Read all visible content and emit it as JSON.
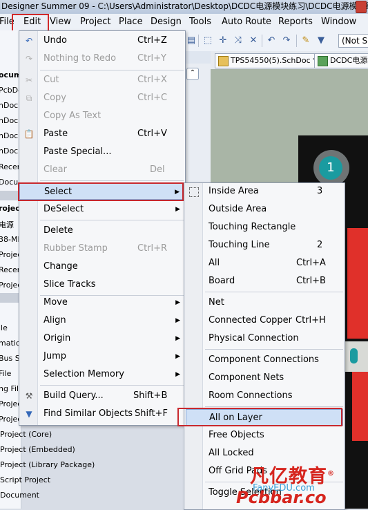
{
  "title": "Designer Summer 09 - C:\\Users\\Administrator\\Desktop\\DCDC电源模块练习\\DCDC电源模块练习",
  "menubar": [
    "File",
    "Edit",
    "View",
    "Project",
    "Place",
    "Design",
    "Tools",
    "Auto Route",
    "Reports",
    "Window"
  ],
  "toolbar": {
    "layer_field": "(Not S"
  },
  "tabs": [
    "TPS54550(5).SchDoc *",
    "DCDC电源模"
  ],
  "left_panel": {
    "rows": [
      "ocum",
      "PcbDoc",
      "hDoc",
      "hDoc",
      "hDoc",
      "hDoc",
      "Recen",
      "Docum",
      "rojec",
      "电源",
      "38-MI",
      "Projec",
      "Recen",
      "Projec",
      "ile",
      "matic S",
      "Bus Sy",
      "File",
      "ng File",
      "Projec",
      "Projec"
    ],
    "project_list": [
      "Project (Core)",
      "Project (Embedded)",
      "Project (Library Package)",
      "Script Project",
      "Document"
    ]
  },
  "pcb": {
    "pad_label": "1"
  },
  "edit_menu": [
    {
      "label": "Undo",
      "shortcut": "Ctrl+Z",
      "icon": "undo-icon",
      "disabled": false
    },
    {
      "label": "Nothing to Redo",
      "shortcut": "Ctrl+Y",
      "icon": "redo-icon",
      "disabled": true
    },
    {
      "label": "Cut",
      "shortcut": "Ctrl+X",
      "icon": "cut-icon",
      "disabled": true
    },
    {
      "label": "Copy",
      "shortcut": "Ctrl+C",
      "icon": "copy-icon",
      "disabled": true
    },
    {
      "label": "Copy As Text",
      "shortcut": "",
      "icon": "",
      "disabled": true
    },
    {
      "label": "Paste",
      "shortcut": "Ctrl+V",
      "icon": "paste-icon",
      "disabled": false
    },
    {
      "label": "Paste Special...",
      "shortcut": "",
      "icon": "",
      "disabled": false
    },
    {
      "label": "Clear",
      "shortcut": "Del",
      "icon": "",
      "disabled": true
    },
    {
      "label": "Select",
      "shortcut": "",
      "icon": "",
      "disabled": false,
      "submenu": true
    },
    {
      "label": "DeSelect",
      "shortcut": "",
      "icon": "",
      "disabled": false,
      "submenu": true
    },
    {
      "label": "Delete",
      "shortcut": "",
      "icon": "",
      "disabled": false
    },
    {
      "label": "Rubber Stamp",
      "shortcut": "Ctrl+R",
      "icon": "rubber-stamp-icon",
      "disabled": true
    },
    {
      "label": "Change",
      "shortcut": "",
      "icon": "",
      "disabled": false
    },
    {
      "label": "Slice Tracks",
      "shortcut": "",
      "icon": "",
      "disabled": false
    },
    {
      "label": "Move",
      "shortcut": "",
      "icon": "",
      "disabled": false,
      "submenu": true
    },
    {
      "label": "Align",
      "shortcut": "",
      "icon": "",
      "disabled": false,
      "submenu": true
    },
    {
      "label": "Origin",
      "shortcut": "",
      "icon": "",
      "disabled": false,
      "submenu": true
    },
    {
      "label": "Jump",
      "shortcut": "",
      "icon": "",
      "disabled": false,
      "submenu": true
    },
    {
      "label": "Selection Memory",
      "shortcut": "",
      "icon": "",
      "disabled": false,
      "submenu": true
    },
    {
      "label": "Build Query...",
      "shortcut": "Shift+B",
      "icon": "build-query-icon",
      "disabled": false
    },
    {
      "label": "Find Similar Objects",
      "shortcut": "Shift+F",
      "icon": "filter-icon",
      "disabled": false
    }
  ],
  "select_menu": [
    {
      "label": "Inside Area",
      "shortcut": "3"
    },
    {
      "label": "Outside Area",
      "shortcut": ""
    },
    {
      "label": "Touching Rectangle",
      "shortcut": ""
    },
    {
      "label": "Touching Line",
      "shortcut": "2"
    },
    {
      "label": "All",
      "shortcut": "Ctrl+A"
    },
    {
      "label": "Board",
      "shortcut": "Ctrl+B"
    },
    {
      "label": "Net",
      "shortcut": ""
    },
    {
      "label": "Connected Copper",
      "shortcut": "Ctrl+H"
    },
    {
      "label": "Physical Connection",
      "shortcut": ""
    },
    {
      "label": "Component Connections",
      "shortcut": ""
    },
    {
      "label": "Component Nets",
      "shortcut": ""
    },
    {
      "label": "Room Connections",
      "shortcut": ""
    },
    {
      "label": "All on Layer",
      "shortcut": ""
    },
    {
      "label": "Free Objects",
      "shortcut": ""
    },
    {
      "label": "All Locked",
      "shortcut": ""
    },
    {
      "label": "Off Grid Pads",
      "shortcut": ""
    },
    {
      "label": "Toggle Selection",
      "shortcut": ""
    }
  ],
  "watermark": {
    "brand_cn": "凡亿教育",
    "registered": "®",
    "site": "FanyEDU.com",
    "logo": "Pcbbar.co"
  },
  "colors": {
    "highlight_box": "#c8282e",
    "brand_red": "#d6251e"
  }
}
